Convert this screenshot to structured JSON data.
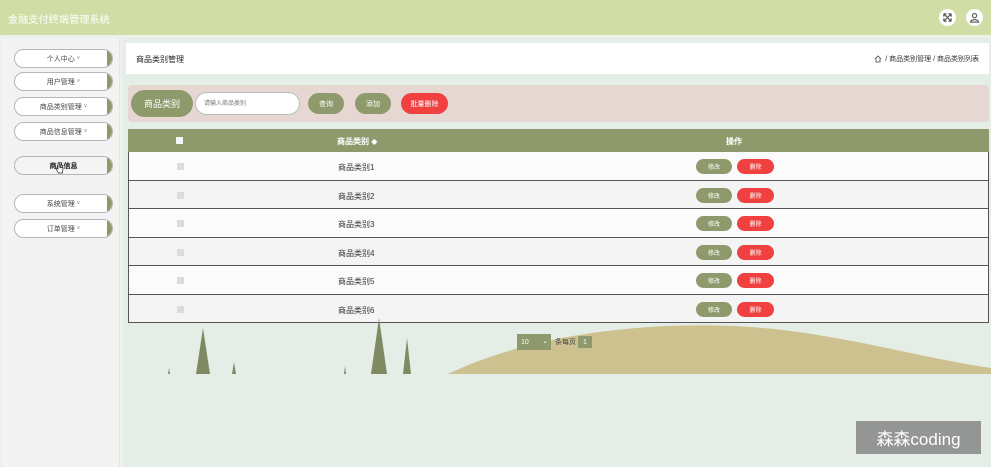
{
  "app": {
    "title": "金融支付终端管理系统"
  },
  "header": {
    "fullscreen_icon": "fullscreen-icon",
    "user_icon": "user-icon"
  },
  "sidebar": {
    "items": [
      {
        "label": "个人中心",
        "arrow": "˅"
      },
      {
        "label": "用户管理",
        "arrow": "˅"
      },
      {
        "label": "商品类别管理",
        "arrow": "˅"
      },
      {
        "label": "商品信息管理",
        "arrow": "˅"
      },
      {
        "label": "商品信息",
        "arrow": ""
      },
      {
        "label": "系统管理",
        "arrow": "˅"
      },
      {
        "label": "订单管理",
        "arrow": "˅"
      }
    ],
    "active_index": 4
  },
  "breadcrumb": {
    "title": "商品类别管理",
    "path": "/ 商品类别管理 / 商品类别列表"
  },
  "search": {
    "label": "商品类别",
    "placeholder": "请输入商品类别",
    "query_button": "查询",
    "add_button": "添加",
    "batch_delete_button": "批量删除"
  },
  "table": {
    "columns": {
      "name": "商品类别 ◆",
      "actions": "操作"
    },
    "edit_label": "修改",
    "delete_label": "删除",
    "rows": [
      {
        "name": "商品类别1"
      },
      {
        "name": "商品类别2"
      },
      {
        "name": "商品类别3"
      },
      {
        "name": "商品类别4"
      },
      {
        "name": "商品类别5"
      },
      {
        "name": "商品类别6"
      }
    ]
  },
  "pagination": {
    "page_size": "10",
    "per_page_label": "条每页",
    "current_page": "1"
  },
  "colors": {
    "accent": "#8e9a6c",
    "danger": "#f04040",
    "topbar": "#d0dea6",
    "search_bg": "#e6d7d3"
  },
  "watermark": "森森coding"
}
